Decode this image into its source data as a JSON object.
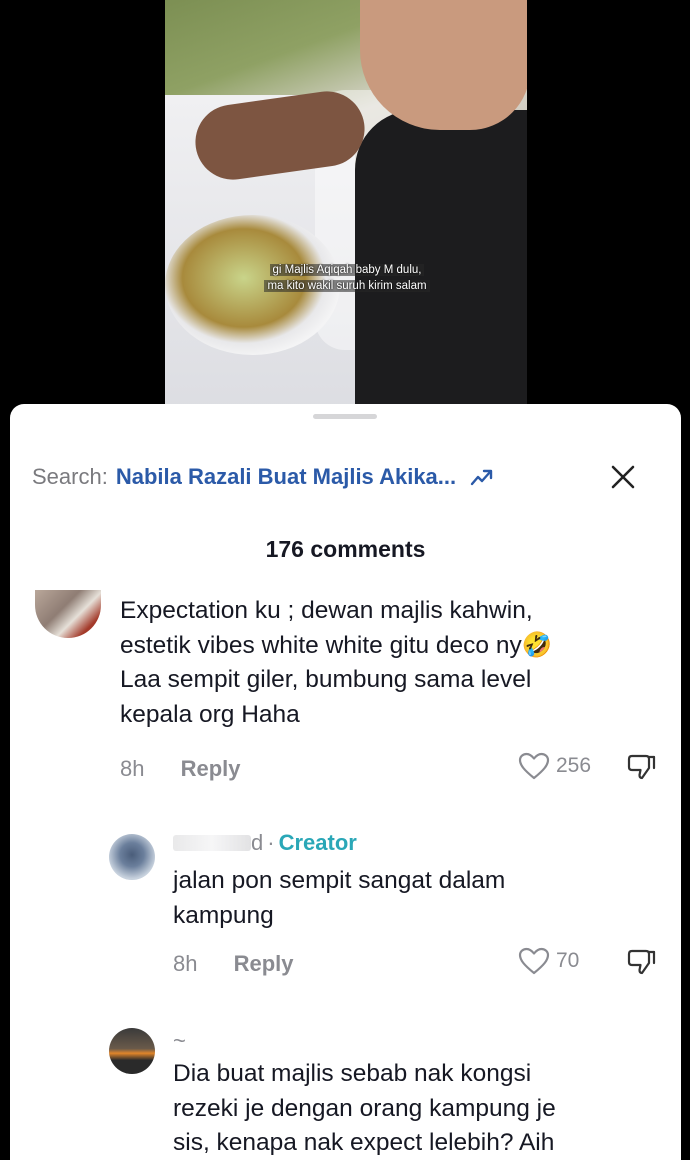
{
  "video": {
    "caption_line1": "gi Majlis Aqiqah baby M dulu,",
    "caption_line2": "ma kito wakil suruh kirim salam"
  },
  "search": {
    "prefix": "Search:",
    "query": "Nabila Razali Buat Majlis Akika..."
  },
  "comments_count": "176 comments",
  "comments": [
    {
      "text_lines": [
        "Expectation ku ; dewan majlis kahwin,",
        "estetik vibes white white gitu deco ny🤣",
        "Laa sempit giler, bumbung sama level",
        "kepala org Haha"
      ],
      "time": "8h",
      "reply_label": "Reply",
      "likes": "256"
    },
    {
      "name_suffix": "d",
      "badge_sep": "·",
      "badge": "Creator",
      "text_lines": [
        "jalan pon sempit sangat dalam",
        "kampung"
      ],
      "time": "8h",
      "reply_label": "Reply",
      "likes": "70"
    },
    {
      "name": "~",
      "text_lines": [
        "Dia buat majlis sebab nak kongsi",
        "rezeki je dengan orang kampung je",
        "sis, kenapa nak expect lelebih? Aih"
      ]
    }
  ],
  "colors": {
    "search_query": "#2b5aa8",
    "creator_badge": "#2aa7b7",
    "secondary_text": "#8a8b91"
  },
  "icons": [
    "trending-icon",
    "close-icon",
    "heart-icon",
    "dislike-icon"
  ]
}
